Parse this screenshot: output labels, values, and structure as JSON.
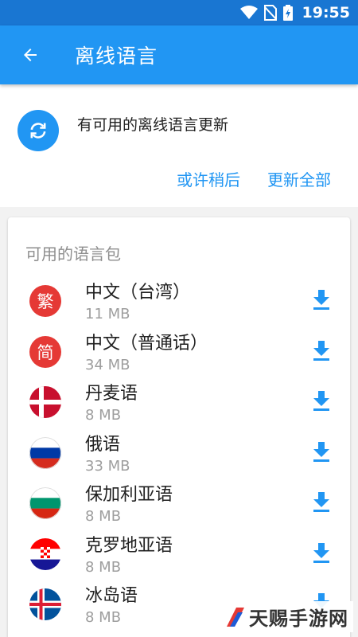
{
  "status_bar": {
    "time": "19:55"
  },
  "app_bar": {
    "title": "离线语言"
  },
  "update_card": {
    "message": "有可用的离线语言更新",
    "later_label": "或许稍后",
    "update_all_label": "更新全部"
  },
  "section_title": "可用的语言包",
  "languages": [
    {
      "name": "中文（台湾）",
      "size": "11 MB",
      "icon": "traditional-chinese-icon",
      "icon_text": "繁"
    },
    {
      "name": "中文（普通话）",
      "size": "34 MB",
      "icon": "simplified-chinese-icon",
      "icon_text": "简"
    },
    {
      "name": "丹麦语",
      "size": "8 MB",
      "icon": "denmark-flag-icon"
    },
    {
      "name": "俄语",
      "size": "33 MB",
      "icon": "russia-flag-icon"
    },
    {
      "name": "保加利亚语",
      "size": "8 MB",
      "icon": "bulgaria-flag-icon"
    },
    {
      "name": "克罗地亚语",
      "size": "8 MB",
      "icon": "croatia-flag-icon"
    },
    {
      "name": "冰岛语",
      "size": "8 MB",
      "icon": "iceland-flag-icon"
    }
  ],
  "watermark": "天赐手游网",
  "colors": {
    "primary": "#2196f3",
    "status_bar": "#1976d2",
    "badge_red": "#e53935"
  }
}
